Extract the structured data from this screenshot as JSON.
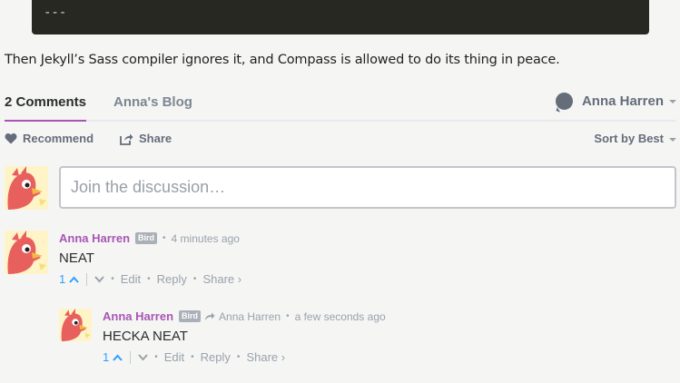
{
  "code": {
    "line": "---"
  },
  "prose": {
    "text": "Then Jekyll’s Sass compiler ignores it, and Compass is allowed to do its thing in peace."
  },
  "tabs": {
    "comments": "2 Comments",
    "blog": "Anna's Blog"
  },
  "user_menu": {
    "name": "Anna Harren"
  },
  "actions": {
    "recommend": "Recommend",
    "share": "Share",
    "sort": "Sort by Best"
  },
  "compose": {
    "placeholder": "Join the discussion…"
  },
  "comments": [
    {
      "author": "Anna Harren",
      "badge": "Bird",
      "time": "4 minutes ago",
      "body": "NEAT",
      "votes": "1",
      "edit": "Edit",
      "reply": "Reply",
      "share": "Share ›"
    },
    {
      "author": "Anna Harren",
      "badge": "Bird",
      "reply_to": "Anna Harren",
      "time": "a few seconds ago",
      "body": "HECKA NEAT",
      "votes": "1",
      "edit": "Edit",
      "reply": "Reply",
      "share": "Share ›"
    }
  ],
  "colors": {
    "accent": "#a855b5",
    "vote": "#2e9fff",
    "code_bg": "#272822"
  }
}
